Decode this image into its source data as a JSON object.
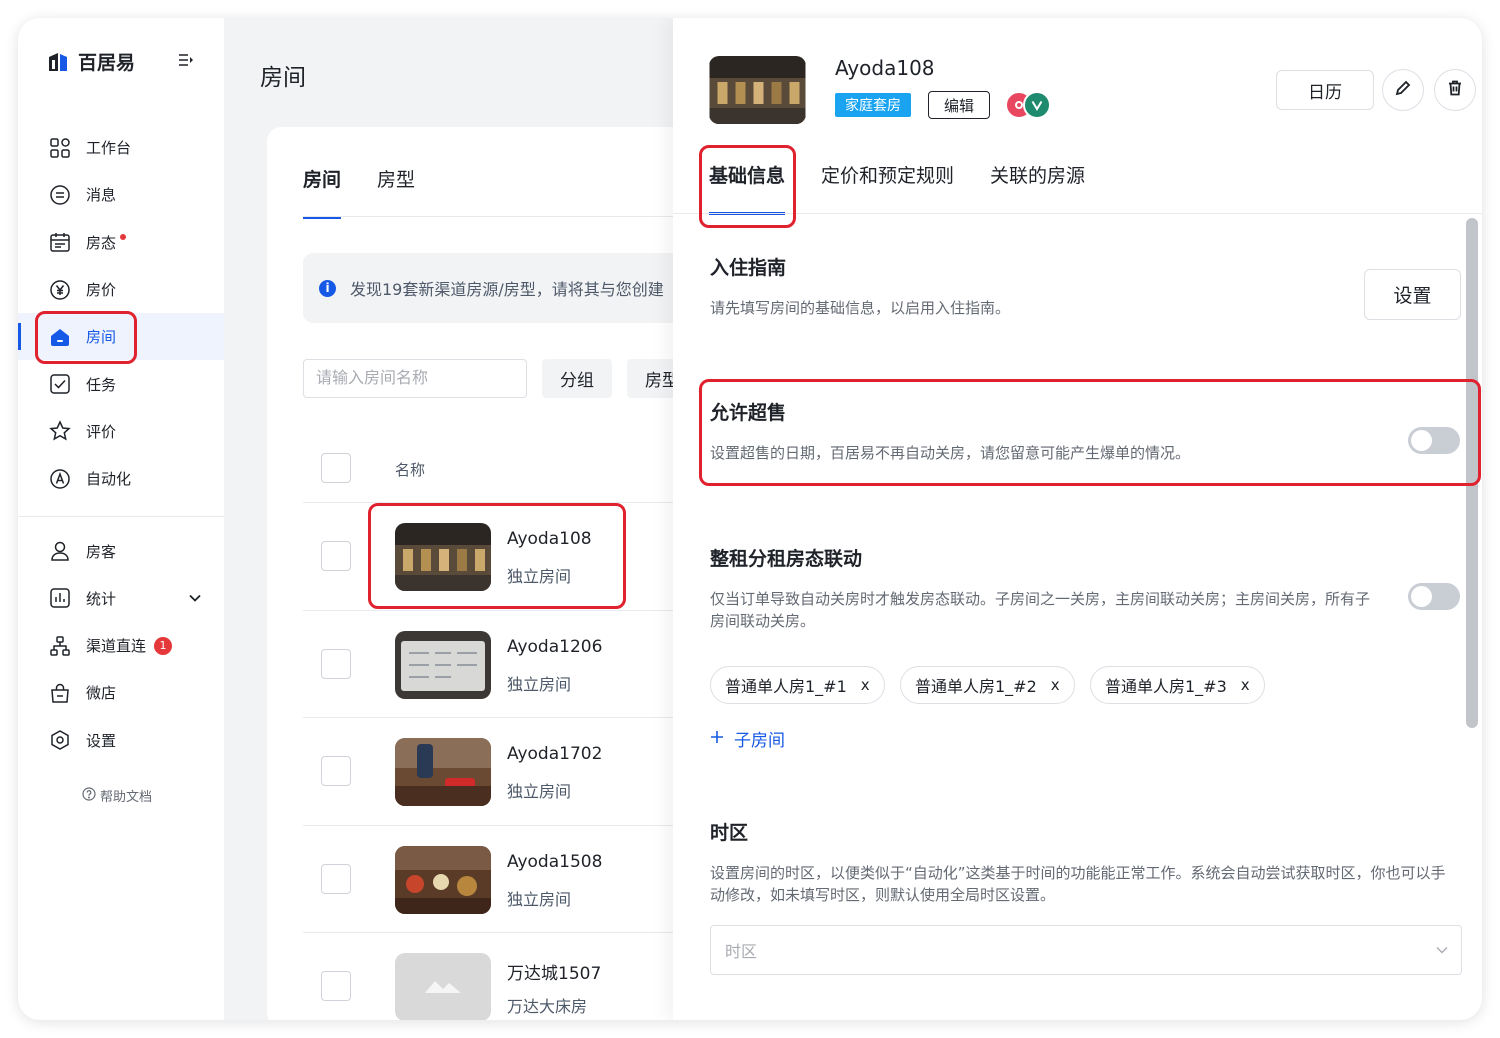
{
  "app": {
    "logo_text": "百居易",
    "page_title": "房间"
  },
  "sidebar": {
    "items": [
      {
        "label": "工作台",
        "icon": "grid-icon"
      },
      {
        "label": "消息",
        "icon": "message-icon"
      },
      {
        "label": "房态",
        "icon": "calendar-icon",
        "dot": true
      },
      {
        "label": "房价",
        "icon": "yen-icon"
      },
      {
        "label": "房间",
        "icon": "home-icon",
        "active": true
      },
      {
        "label": "任务",
        "icon": "checkbox-icon"
      },
      {
        "label": "评价",
        "icon": "star-icon"
      },
      {
        "label": "自动化",
        "icon": "automation-icon"
      }
    ],
    "items2": [
      {
        "label": "房客",
        "icon": "user-icon"
      },
      {
        "label": "统计",
        "icon": "chart-icon",
        "expandable": true
      },
      {
        "label": "渠道直连",
        "icon": "channel-icon",
        "badge": "1"
      },
      {
        "label": "微店",
        "icon": "shop-icon"
      },
      {
        "label": "设置",
        "icon": "settings-icon"
      }
    ],
    "help": "帮助文档"
  },
  "list": {
    "tabs": [
      "房间",
      "房型"
    ],
    "notice": "发现19套新渠道房源/房型，请将其与您创建",
    "search_placeholder": "请输入房间名称",
    "group_btn": "分组",
    "type_btn": "房型",
    "col_name": "名称",
    "rows": [
      {
        "name": "Ayoda108",
        "type": "独立房间"
      },
      {
        "name": "Ayoda1206",
        "type": "独立房间"
      },
      {
        "name": "Ayoda1702",
        "type": "独立房间"
      },
      {
        "name": "Ayoda1508",
        "type": "独立房间"
      },
      {
        "name": "万达城1507",
        "type": "万达大床房"
      }
    ]
  },
  "drawer": {
    "title": "Ayoda108",
    "tag": "家庭套房",
    "edit": "编辑",
    "calendar_btn": "日历",
    "tabs": [
      "基础信息",
      "定价和预定规则",
      "关联的房源"
    ],
    "checkin": {
      "title": "入住指南",
      "desc": "请先填写房间的基础信息，以启用入住指南。",
      "button": "设置"
    },
    "overbooking": {
      "title": "允许超售",
      "desc": "设置超售的日期，百居易不再自动关房，请您留意可能产生爆单的情况。",
      "enabled": false
    },
    "linkage": {
      "title": "整租分租房态联动",
      "desc": "仅当订单导致自动关房时才触发房态联动。子房间之一关房，主房间联动关房；主房间关房，所有子房间联动关房。",
      "enabled": false,
      "chips": [
        "普通单人房1_#1",
        "普通单人房1_#2",
        "普通单人房1_#3"
      ],
      "chip_close": "x",
      "add": "子房间"
    },
    "timezone": {
      "title": "时区",
      "desc": "设置房间的时区，以便类似于“自动化”这类基于时间的功能能正常工作。系统会自动尝试获取时区，你也可以手动修改，如未填写时区，则默认使用全局时区设置。",
      "placeholder": "时区"
    }
  },
  "colors": {
    "accent": "#1659e6",
    "highlight": "#e0222f",
    "tag": "#1aa3f0"
  }
}
